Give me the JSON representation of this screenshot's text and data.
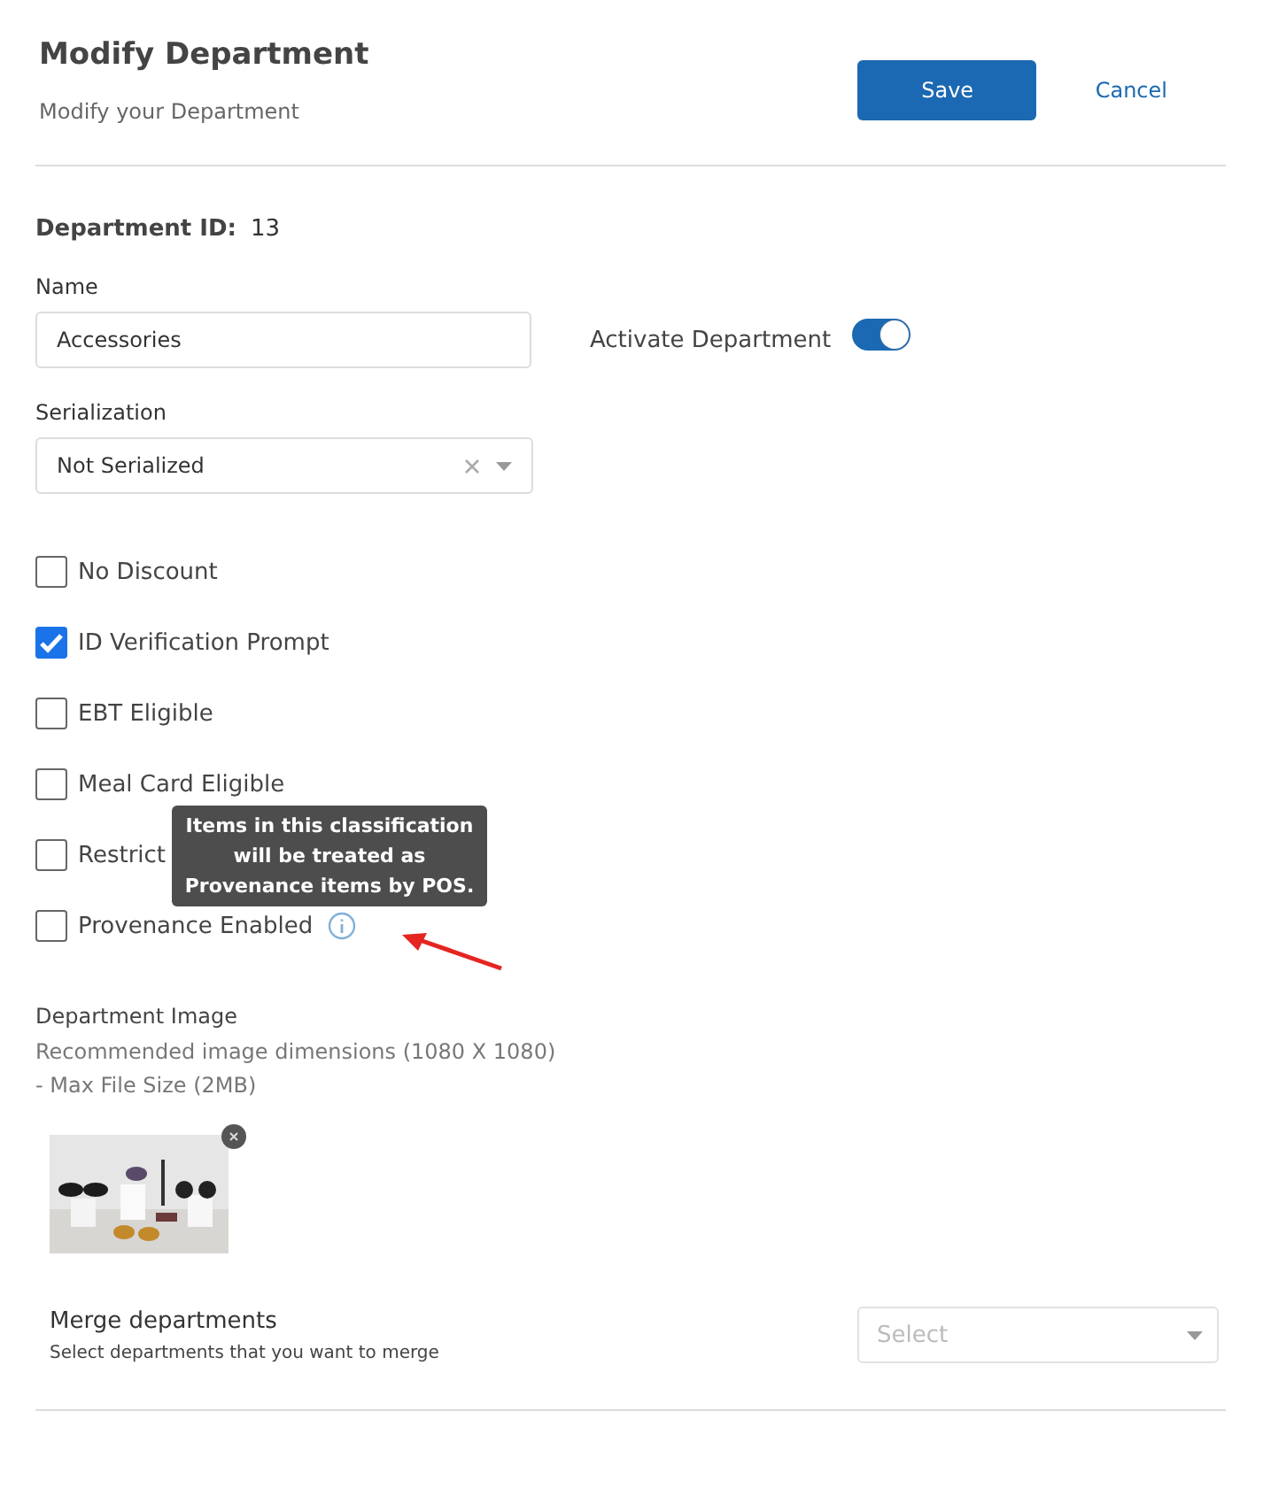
{
  "header": {
    "title": "Modify Department",
    "subtitle": "Modify your Department",
    "save": "Save",
    "cancel": "Cancel"
  },
  "department_id": {
    "label": "Department ID:",
    "value": "13"
  },
  "name": {
    "label": "Name",
    "value": "Accessories"
  },
  "activate": {
    "label": "Activate Department",
    "on": true
  },
  "serialization": {
    "label": "Serialization",
    "value": "Not Serialized"
  },
  "options": [
    {
      "label": "No Discount",
      "checked": false
    },
    {
      "label": "ID Verification Prompt",
      "checked": true
    },
    {
      "label": "EBT Eligible",
      "checked": false
    },
    {
      "label": "Meal Card Eligible",
      "checked": false
    },
    {
      "label": "Restrict",
      "checked": false
    },
    {
      "label": "Provenance Enabled",
      "checked": false,
      "tooltip": "Items in this classification will be treated as Provenance items by POS."
    }
  ],
  "image": {
    "label": "Department Image",
    "hint": "Recommended image dimensions (1080 X 1080) - Max File Size (2MB)",
    "kind": "picture"
  },
  "merge": {
    "title": "Merge departments",
    "description": "Select departments that you want to merge",
    "placeholder": "Select"
  }
}
